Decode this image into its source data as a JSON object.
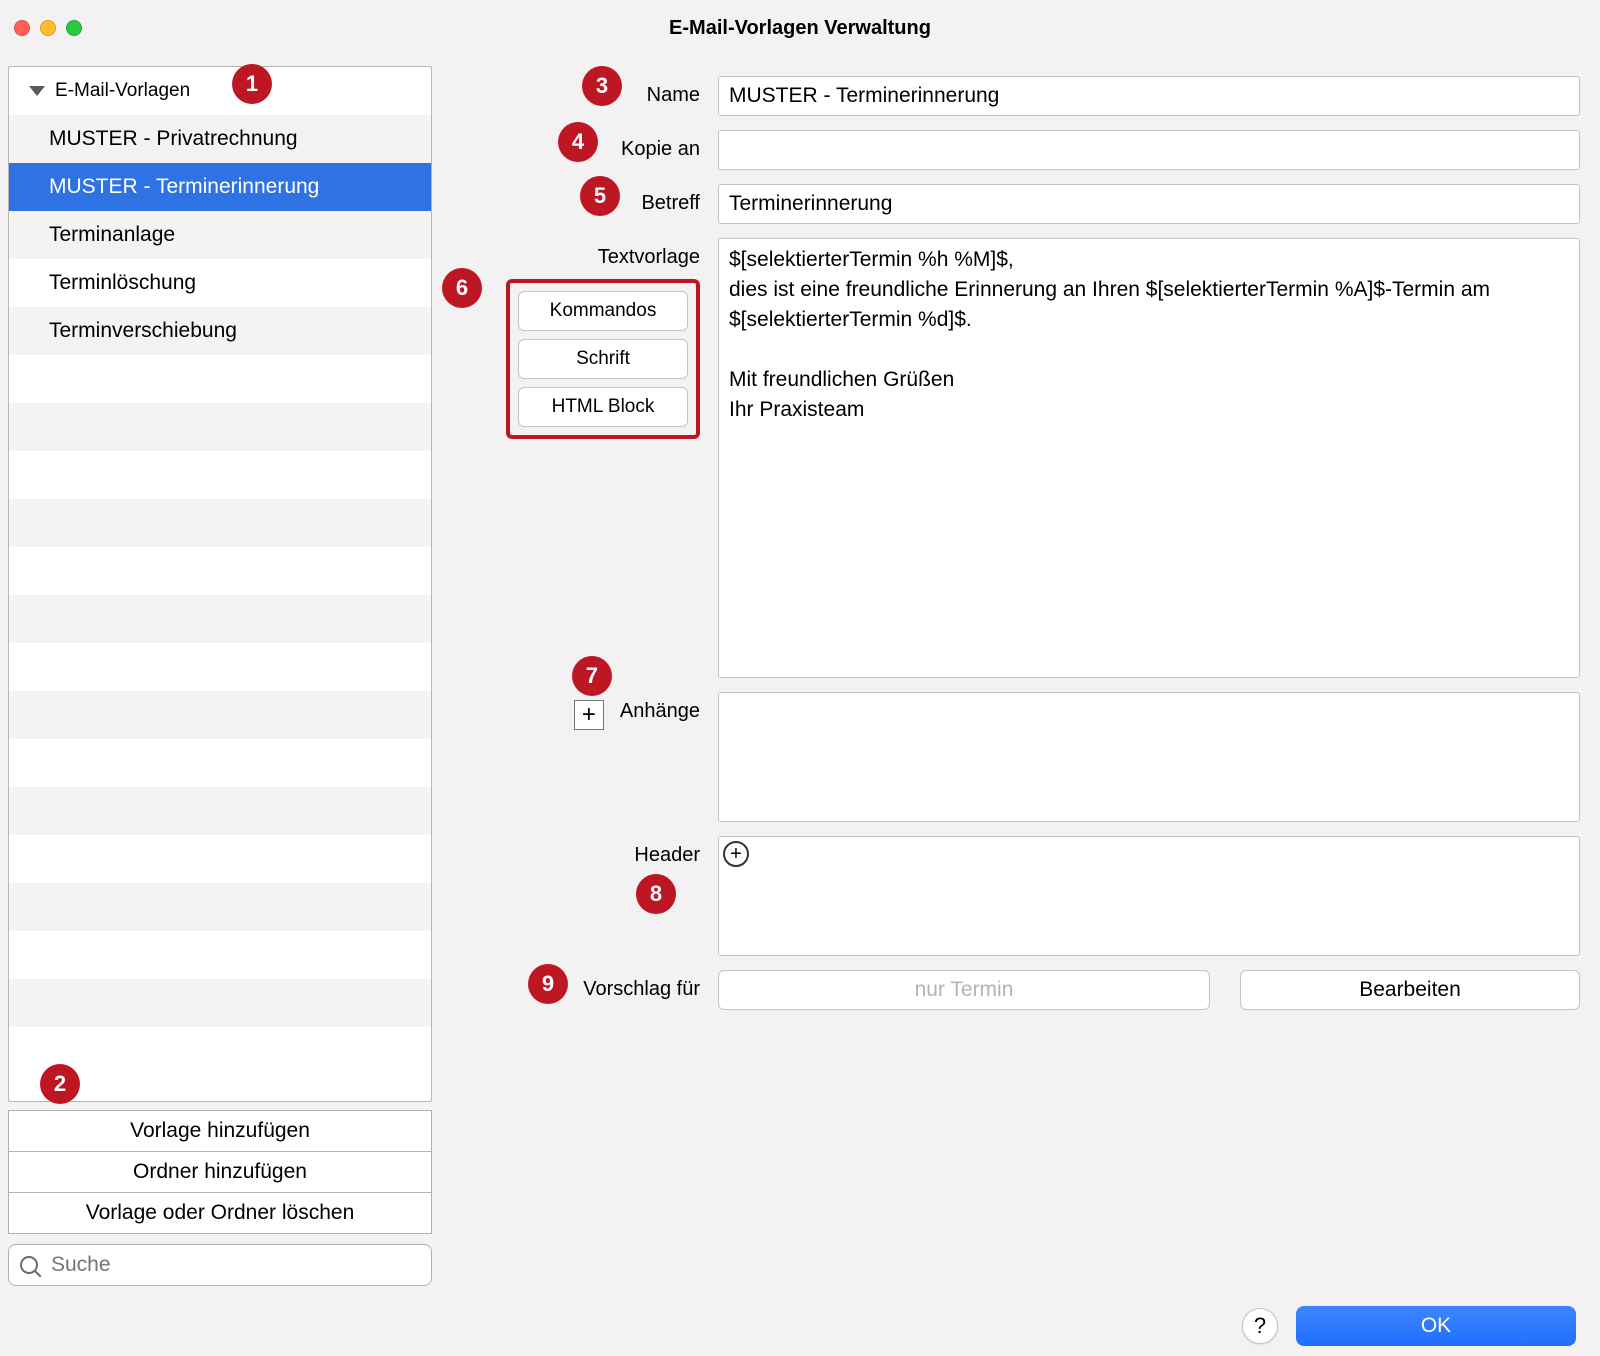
{
  "window": {
    "title": "E-Mail-Vorlagen Verwaltung"
  },
  "sidebar": {
    "root_label": "E-Mail-Vorlagen",
    "items": [
      "MUSTER - Privatrechnung",
      "MUSTER - Terminerinnerung",
      "Terminanlage",
      "Terminlöschung",
      "Terminverschiebung"
    ],
    "selected_index": 1,
    "add_template_label": "Vorlage hinzufügen",
    "add_folder_label": "Ordner hinzufügen",
    "delete_label": "Vorlage oder Ordner löschen",
    "search_placeholder": "Suche"
  },
  "form": {
    "name_label": "Name",
    "name_value": "MUSTER - Terminerinnerung",
    "cc_label": "Kopie an",
    "cc_value": "",
    "subject_label": "Betreff",
    "subject_value": "Terminerinnerung",
    "text_label": "Textvorlage",
    "text_value": "$[selektierterTermin %h %M]$,\ndies ist eine freundliche Erinnerung an Ihren $[selektierterTermin %A]$-Termin am $[selektierterTermin %d]$.\n\nMit freundlichen Grüßen\nIhr Praxisteam",
    "tools": {
      "commands": "Kommandos",
      "font": "Schrift",
      "html": "HTML Block"
    },
    "attach_label": "Anhänge",
    "header_label": "Header",
    "suggest_label": "Vorschlag für",
    "suggest_value": "nur Termin",
    "edit_label": "Bearbeiten"
  },
  "footer": {
    "help_label": "?",
    "ok_label": "OK"
  },
  "callouts": [
    "1",
    "2",
    "3",
    "4",
    "5",
    "6",
    "7",
    "8",
    "9"
  ]
}
